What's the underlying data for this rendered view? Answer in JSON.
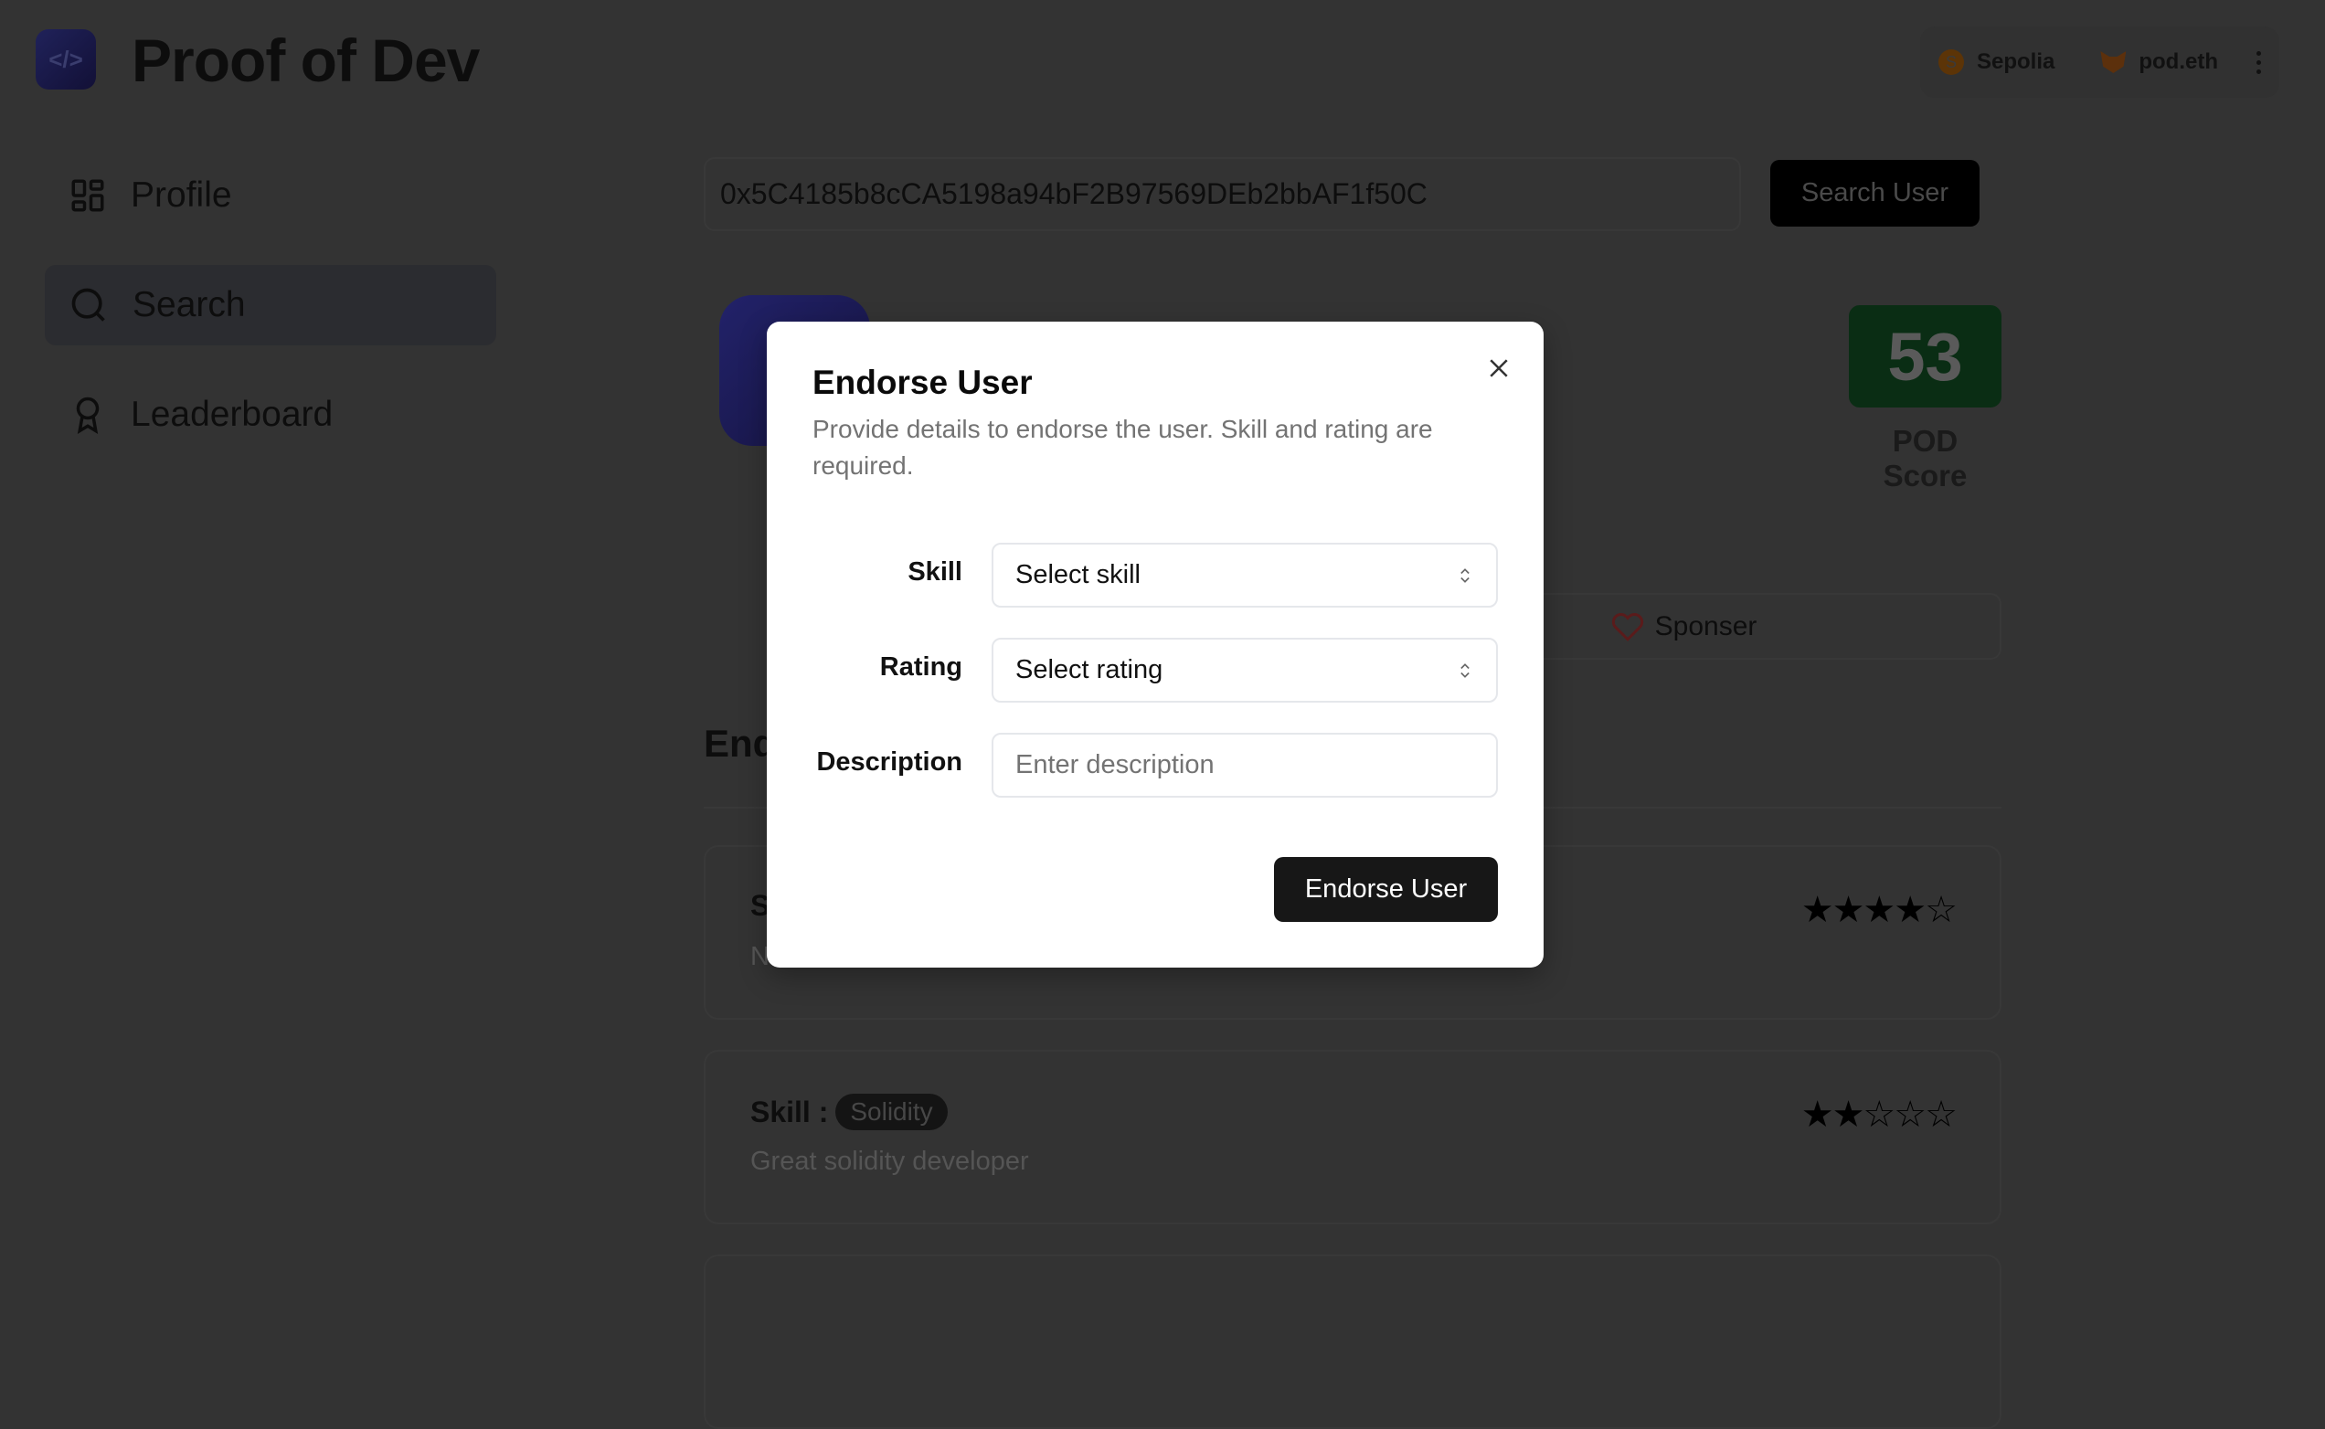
{
  "app": {
    "title": "Proof of Dev",
    "logo_icon": "code-icon"
  },
  "wallet": {
    "network": "Sepolia",
    "network_initial": "S",
    "account": "pod.eth"
  },
  "sidebar": {
    "items": [
      {
        "label": "Profile",
        "icon": "grid-icon",
        "active": false
      },
      {
        "label": "Search",
        "icon": "search-icon",
        "active": true
      },
      {
        "label": "Leaderboard",
        "icon": "award-icon",
        "active": false
      }
    ]
  },
  "search": {
    "value": "0x5C4185b8cCA5198a94bF2B97569DEb2bbAF1f50C",
    "button_label": "Search User"
  },
  "profile": {
    "pod_score": "53",
    "pod_score_label": "POD Score",
    "sponser_label": "Sponser"
  },
  "endorsements": {
    "heading": "Endorsements",
    "items": [
      {
        "skill_label": "Skill :",
        "skill": "",
        "description": "N",
        "rating": 4,
        "max_rating": 5
      },
      {
        "skill_label": "Skill :",
        "skill": "Solidity",
        "description": "Great solidity developer",
        "rating": 2,
        "max_rating": 5
      }
    ]
  },
  "modal": {
    "title": "Endorse User",
    "description": "Provide details to endorse the user. Skill and rating are required.",
    "fields": {
      "skill": {
        "label": "Skill",
        "placeholder": "Select skill"
      },
      "rating": {
        "label": "Rating",
        "placeholder": "Select rating"
      },
      "description": {
        "label": "Description",
        "placeholder": "Enter description"
      }
    },
    "submit_label": "Endorse User"
  },
  "colors": {
    "score_green": "#16a34a",
    "overlay": "rgba(0,0,0,0.8)",
    "primary": "#171717",
    "heart": "#dc2626"
  }
}
